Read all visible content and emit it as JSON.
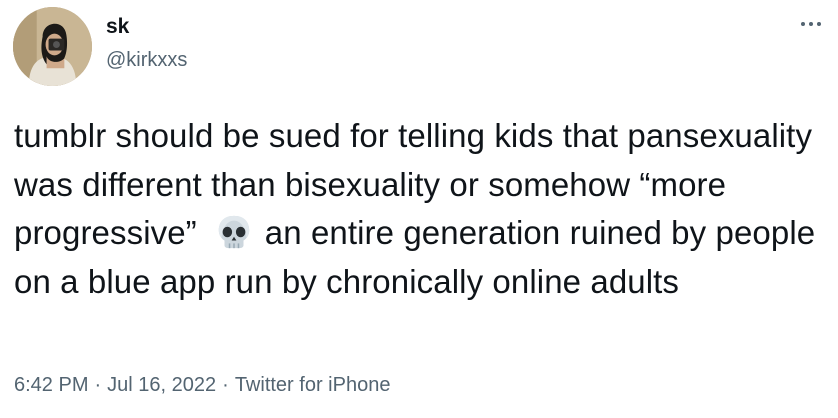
{
  "author": {
    "display_name": "sk",
    "handle": "@kirkxxs",
    "avatar_icon": "profile-photo"
  },
  "menu": {
    "icon": "more-horizontal-icon"
  },
  "tweet": {
    "text_part1": "tumblr should be sued for telling kids that pansexuality was different than bisexuality or somehow “more progressive”",
    "emoji_icon": "skull-emoji",
    "text_part2": "an entire generation ruined by people on a blue app run by chronically online adults"
  },
  "meta": {
    "time": "6:42 PM",
    "separator": "·",
    "date": "Jul 16, 2022",
    "source": "Twitter for iPhone"
  },
  "colors": {
    "text_primary": "#0f1419",
    "text_secondary": "#536471",
    "background": "#ffffff"
  }
}
